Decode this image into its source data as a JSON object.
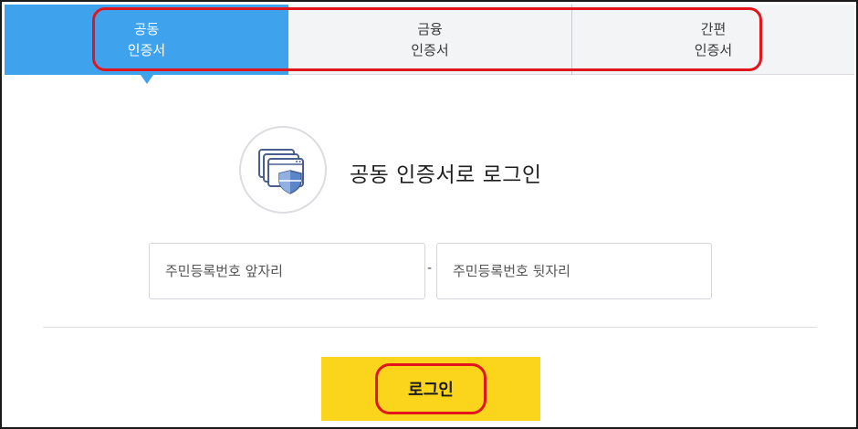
{
  "tabs": [
    {
      "line1": "공동",
      "line2": "인증서",
      "active": true
    },
    {
      "line1": "금융",
      "line2": "인증서",
      "active": false
    },
    {
      "line1": "간편",
      "line2": "인증서",
      "active": false
    }
  ],
  "login": {
    "title": "공동 인증서로 로그인",
    "icon": "certificate-shield-icon",
    "fields": {
      "front_placeholder": "주민등록번호 앞자리",
      "back_placeholder": "주민등록번호 뒷자리",
      "separator": "-"
    },
    "button_label": "로그인"
  },
  "colors": {
    "active_tab": "#3ea2ed",
    "button": "#fbd51c",
    "annotation": "#e3151c"
  }
}
